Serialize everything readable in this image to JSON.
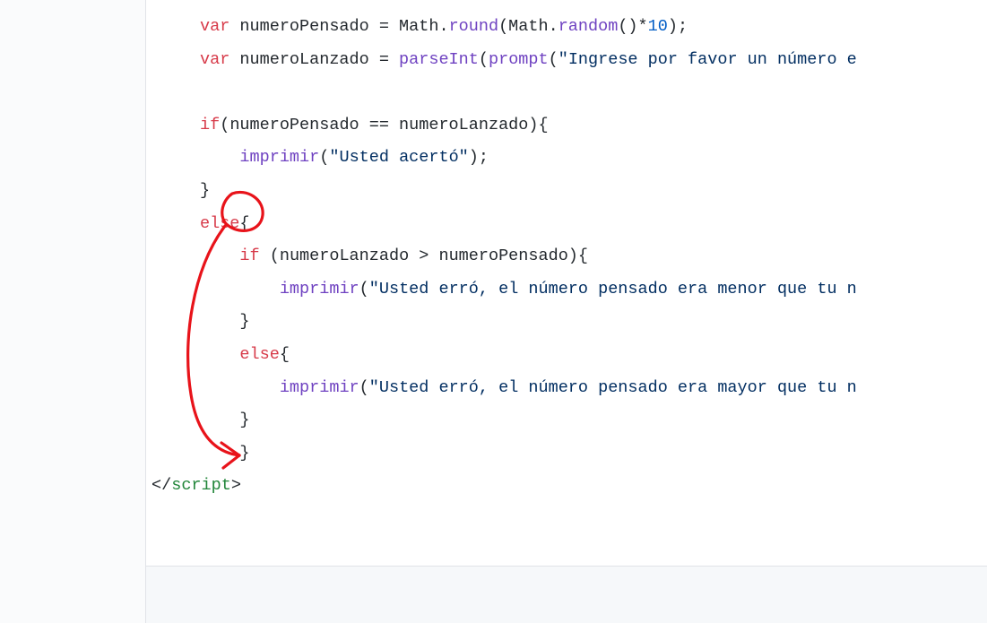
{
  "code": {
    "line1_var": "var",
    "line1_rest": " numeroPensado = Math.",
    "line1_fn1": "round",
    "line1_mid": "(Math.",
    "line1_fn2": "random",
    "line1_paren": "()*",
    "line1_num": "10",
    "line1_end": ");",
    "line2_var": "var",
    "line2_rest": " numeroLanzado = ",
    "line2_fn1": "parseInt",
    "line2_p1": "(",
    "line2_fn2": "prompt",
    "line2_p2": "(",
    "line2_str": "\"Ingrese por favor un número e",
    "line3_blank": "",
    "line4_if": "if",
    "line4_rest": "(numeroPensado == numeroLanzado){",
    "line5_indent": "    ",
    "line5_fn": "imprimir",
    "line5_p": "(",
    "line5_str": "\"Usted acertó\"",
    "line5_end": ");",
    "line6": "}",
    "line7_else": "else",
    "line7_brace": "{",
    "line8_indent": "    ",
    "line8_if": "if",
    "line8_rest": " (numeroLanzado > numeroPensado){",
    "line9_indent": "        ",
    "line9_fn": "imprimir",
    "line9_p": "(",
    "line9_str": "\"Usted erró, el número pensado era menor que tu n",
    "line10": "    }",
    "line11_indent": "    ",
    "line11_else": "else",
    "line11_brace": "{",
    "line12_indent": "        ",
    "line12_fn": "imprimir",
    "line12_p": "(",
    "line12_str": "\"Usted erró, el número pensado era mayor que tu n",
    "line13": "    }",
    "line14": "    }",
    "line15_open": "</",
    "line15_tag": "script",
    "line15_close": ">"
  }
}
